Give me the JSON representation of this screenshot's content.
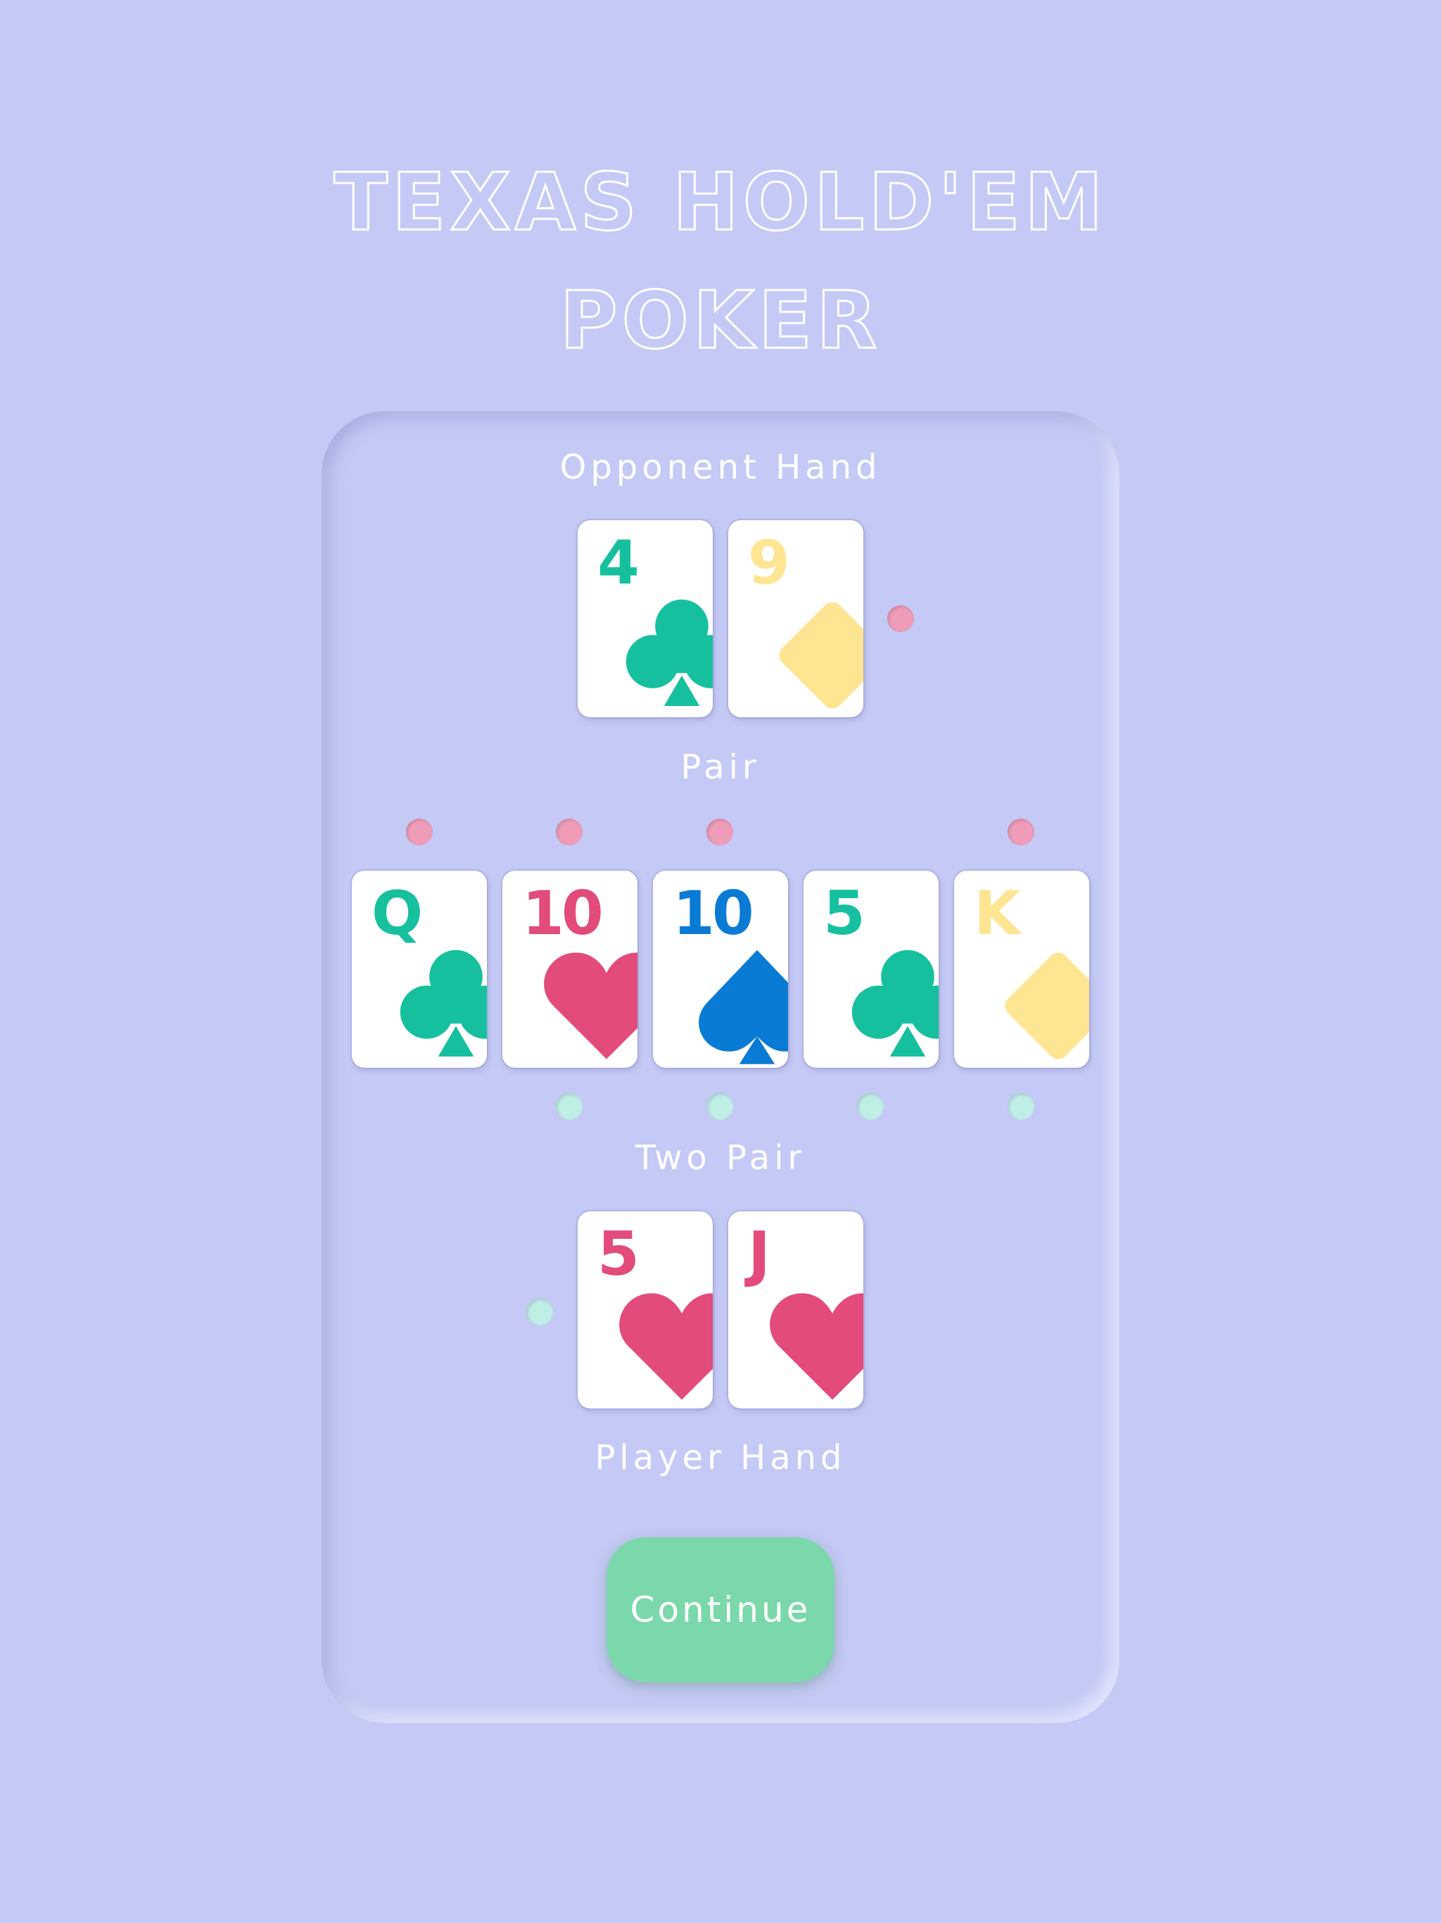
{
  "title": {
    "line1": "TEXAS HOLD'EM",
    "line2": "POKER"
  },
  "opponent": {
    "label": "Opponent Hand",
    "result": "Pair",
    "cards": [
      {
        "rank": "4",
        "suit": "club",
        "color": "#16c09e"
      },
      {
        "rank": "9",
        "suit": "diamond",
        "color": "#fee592"
      }
    ]
  },
  "community": {
    "cards": [
      {
        "rank": "Q",
        "suit": "club",
        "color": "#16c09e"
      },
      {
        "rank": "10",
        "suit": "heart",
        "color": "#e24b7a"
      },
      {
        "rank": "10",
        "suit": "spade",
        "color": "#0a7bd4"
      },
      {
        "rank": "5",
        "suit": "club",
        "color": "#16c09e"
      },
      {
        "rank": "K",
        "suit": "diamond",
        "color": "#fee592"
      }
    ]
  },
  "player": {
    "label": "Player Hand",
    "result": "Two Pair",
    "cards": [
      {
        "rank": "5",
        "suit": "heart",
        "color": "#e24b7a"
      },
      {
        "rank": "J",
        "suit": "heart",
        "color": "#e24b7a"
      }
    ]
  },
  "indicators": {
    "opponent_color": "#ee9cb8",
    "player_color": "#bfeee6"
  },
  "button": {
    "label": "Continue",
    "color": "#7ad8ab"
  }
}
